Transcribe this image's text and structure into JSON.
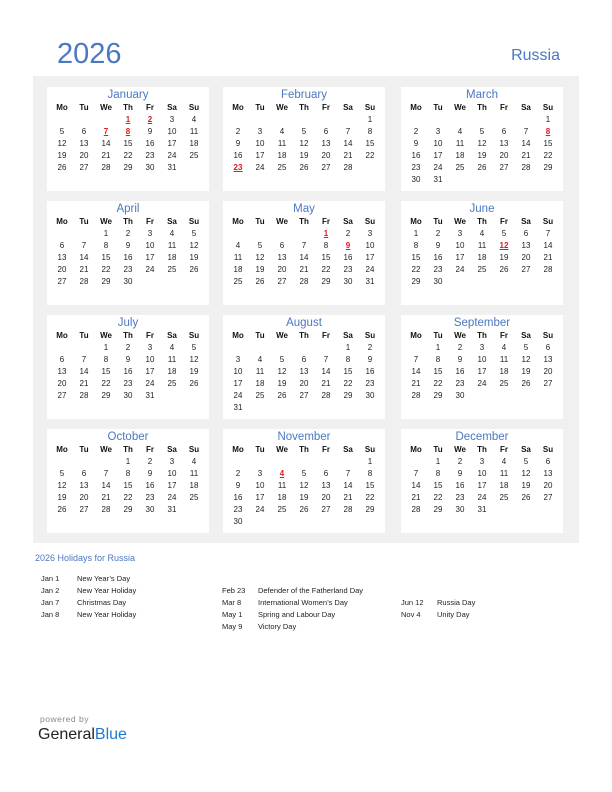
{
  "header": {
    "year": "2026",
    "country": "Russia"
  },
  "weekdays": [
    "Mo",
    "Tu",
    "We",
    "Th",
    "Fr",
    "Sa",
    "Su"
  ],
  "months": [
    {
      "name": "January",
      "offset": 3,
      "days": 31,
      "holidays": [
        1,
        2,
        7,
        8
      ]
    },
    {
      "name": "February",
      "offset": 6,
      "days": 28,
      "holidays": [
        23
      ]
    },
    {
      "name": "March",
      "offset": 6,
      "days": 31,
      "holidays": [
        8
      ]
    },
    {
      "name": "April",
      "offset": 2,
      "days": 30,
      "holidays": []
    },
    {
      "name": "May",
      "offset": 4,
      "days": 31,
      "holidays": [
        1,
        9
      ]
    },
    {
      "name": "June",
      "offset": 0,
      "days": 30,
      "holidays": [
        12
      ]
    },
    {
      "name": "July",
      "offset": 2,
      "days": 31,
      "holidays": []
    },
    {
      "name": "August",
      "offset": 5,
      "days": 31,
      "holidays": []
    },
    {
      "name": "September",
      "offset": 1,
      "days": 30,
      "holidays": []
    },
    {
      "name": "October",
      "offset": 3,
      "days": 31,
      "holidays": []
    },
    {
      "name": "November",
      "offset": 6,
      "days": 30,
      "holidays": [
        4
      ]
    },
    {
      "name": "December",
      "offset": 1,
      "days": 31,
      "holidays": []
    }
  ],
  "holidays_section": {
    "title": "2026 Holidays for Russia",
    "columns": [
      [
        {
          "date": "Jan 1",
          "name": "New Year’s Day"
        },
        {
          "date": "Jan 2",
          "name": "New Year Holiday"
        },
        {
          "date": "Jan 7",
          "name": "Christmas Day"
        },
        {
          "date": "Jan 8",
          "name": "New Year Holiday"
        }
      ],
      [
        {
          "date": "Feb 23",
          "name": "Defender of the Fatherland Day"
        },
        {
          "date": "Mar 8",
          "name": "International Women’s Day"
        },
        {
          "date": "May 1",
          "name": "Spring and Labour Day"
        },
        {
          "date": "May 9",
          "name": "Victory Day"
        }
      ],
      [
        {
          "date": "Jun 12",
          "name": "Russia Day"
        },
        {
          "date": "Nov 4",
          "name": "Unity Day"
        }
      ]
    ]
  },
  "footer": {
    "powered_by": "powered by",
    "brand_general": "General",
    "brand_blue": "Blue"
  },
  "colors": {
    "accent": "#4a78c2",
    "holiday": "#e0191c",
    "panel": "#f0f0f0"
  }
}
